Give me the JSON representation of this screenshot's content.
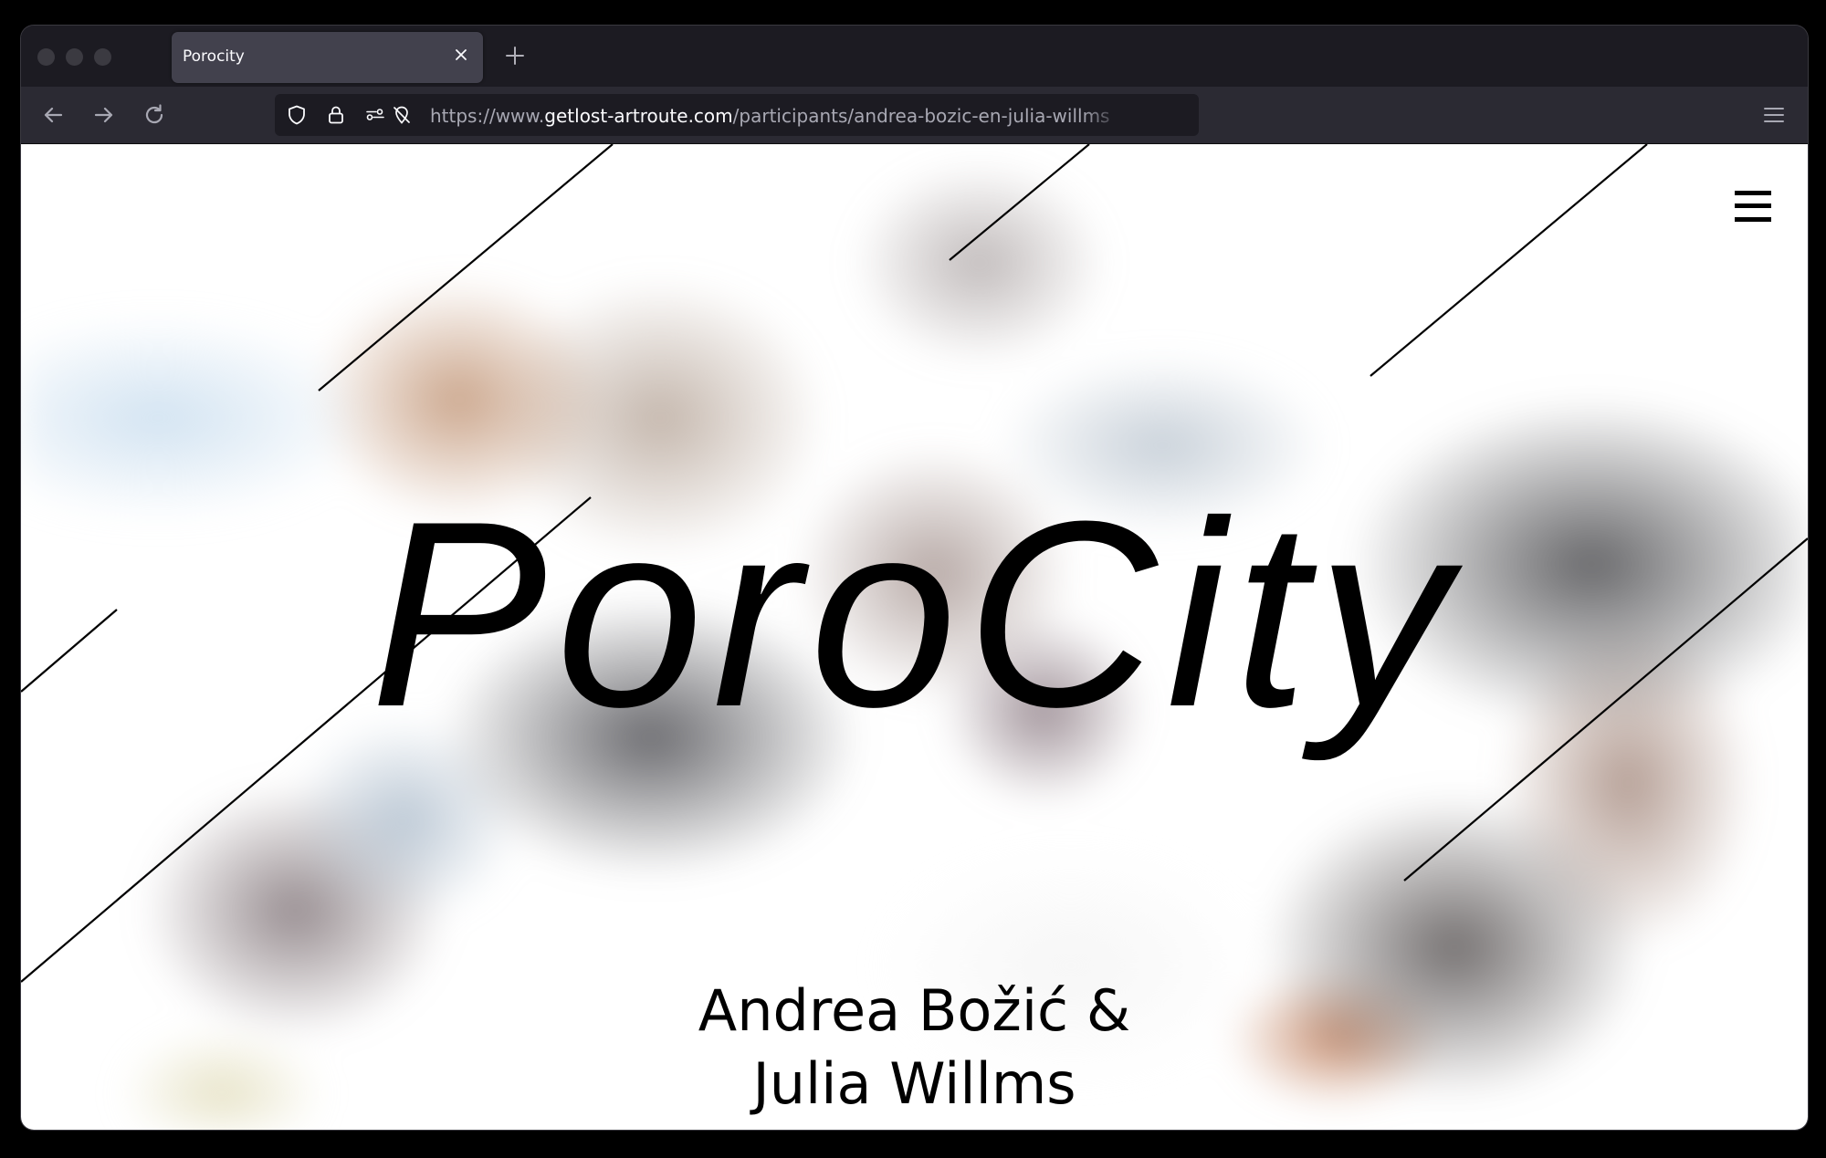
{
  "browser": {
    "tab": {
      "title": "Porocity",
      "close_icon": "close-icon"
    },
    "new_tab_icon": "plus-icon",
    "nav": {
      "back_icon": "arrow-left-icon",
      "forward_icon": "arrow-right-icon",
      "reload_icon": "reload-icon"
    },
    "urlbar": {
      "scheme_prefix": "https://www.",
      "host": "getlost-artroute.com",
      "path": "/participants/andrea-bozic-en-julia-willms",
      "icons": [
        "shield-icon",
        "lock-icon",
        "permissions-icon",
        "tracking-protection-icon"
      ]
    },
    "app_menu_icon": "hamburger-icon"
  },
  "page": {
    "title": "PoroCity",
    "artists_line1": "Andrea Božić &",
    "artists_line2": "Julia Willms",
    "menu_icon": "hamburger-icon"
  },
  "colors": {
    "chrome_bg": "#1c1b22",
    "toolbar_bg": "#2b2a33",
    "tab_bg": "#42414d",
    "text_light": "#fbfbfe",
    "page_text": "#000000"
  }
}
